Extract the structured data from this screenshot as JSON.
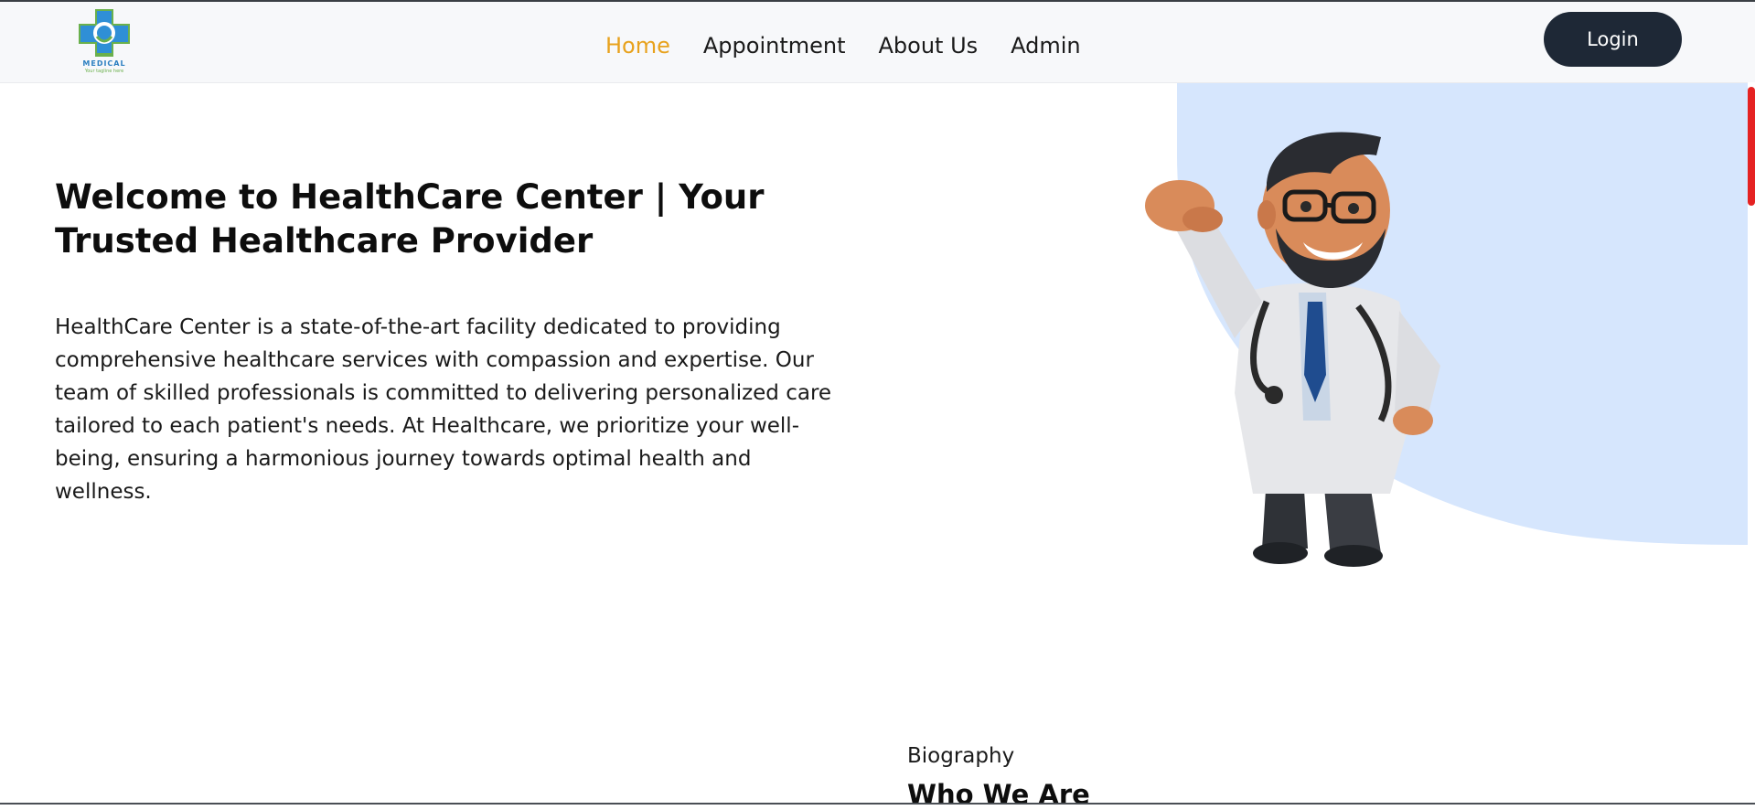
{
  "header": {
    "logo": {
      "text": "MEDICAL",
      "tagline": "Your tagline here",
      "icon": "medical-cross-icon"
    },
    "nav": [
      {
        "label": "Home",
        "active": true
      },
      {
        "label": "Appointment",
        "active": false
      },
      {
        "label": "About Us",
        "active": false
      },
      {
        "label": "Admin",
        "active": false
      }
    ],
    "login_label": "Login"
  },
  "hero": {
    "title": "Welcome to HealthCare Center | Your Trusted Healthcare Provider",
    "description": "HealthCare Center is a state-of-the-art facility dedicated to providing comprehensive healthcare services with compassion and expertise. Our team of skilled professionals is committed to delivering personalized care tailored to each patient's needs. At Healthcare, we prioritize your well-being, ensuring a harmonious journey towards optimal health and wellness.",
    "illustration": "doctor-cartoon-illustration"
  },
  "about": {
    "label": "Biography",
    "heading": "Who We Are"
  },
  "colors": {
    "accent": "#e8a21d",
    "login_bg": "#1e2836",
    "blob": "#d6e6fd",
    "scrollbar": "#e52222"
  }
}
